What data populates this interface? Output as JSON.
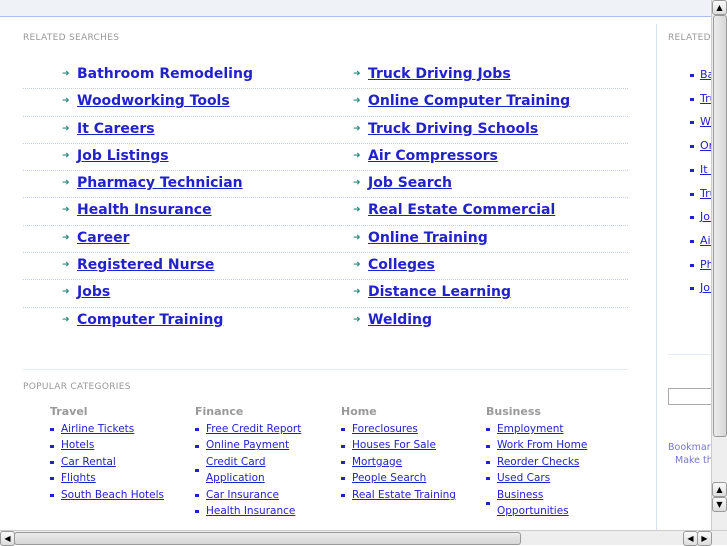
{
  "related_searches": {
    "heading": "RELATED SEARCHES",
    "left": [
      "Bathroom Remodeling",
      "Woodworking Tools",
      "It Careers",
      "Job Listings",
      "Pharmacy Technician",
      "Health Insurance",
      "Career",
      "Registered Nurse",
      "Jobs",
      "Computer Training"
    ],
    "right": [
      "Truck Driving Jobs",
      "Online Computer Training",
      "Truck Driving Schools",
      "Air Compressors",
      "Job Search",
      "Real Estate Commercial",
      "Online Training",
      "Colleges",
      "Distance Learning",
      "Welding"
    ]
  },
  "popular_categories": {
    "heading": "POPULAR CATEGORIES",
    "columns": [
      {
        "title": "Travel",
        "links": [
          "Airline Tickets",
          "Hotels",
          "Car Rental",
          "Flights",
          "South Beach Hotels"
        ]
      },
      {
        "title": "Finance",
        "links": [
          "Free Credit Report",
          "Online Payment",
          "Credit Card Application",
          "Car Insurance",
          "Health Insurance"
        ]
      },
      {
        "title": "Home",
        "links": [
          "Foreclosures",
          "Houses For Sale",
          "Mortgage",
          "People Search",
          "Real Estate Training"
        ]
      },
      {
        "title": "Business",
        "links": [
          "Employment",
          "Work From Home",
          "Reorder Checks",
          "Used Cars",
          "Business Opportunities"
        ]
      }
    ]
  },
  "sidebar": {
    "heading": "RELATED",
    "links": [
      "Ba",
      "Tru",
      "Wo",
      "Or",
      "It C",
      "Tru",
      "Job",
      "Air",
      "Ph",
      "Job"
    ],
    "bookmark": "Bookmark",
    "make": "Make thi"
  },
  "colors": {
    "link": "#2222cc",
    "arrow": "#2a8a7a",
    "topbar": "#eff3f8"
  }
}
